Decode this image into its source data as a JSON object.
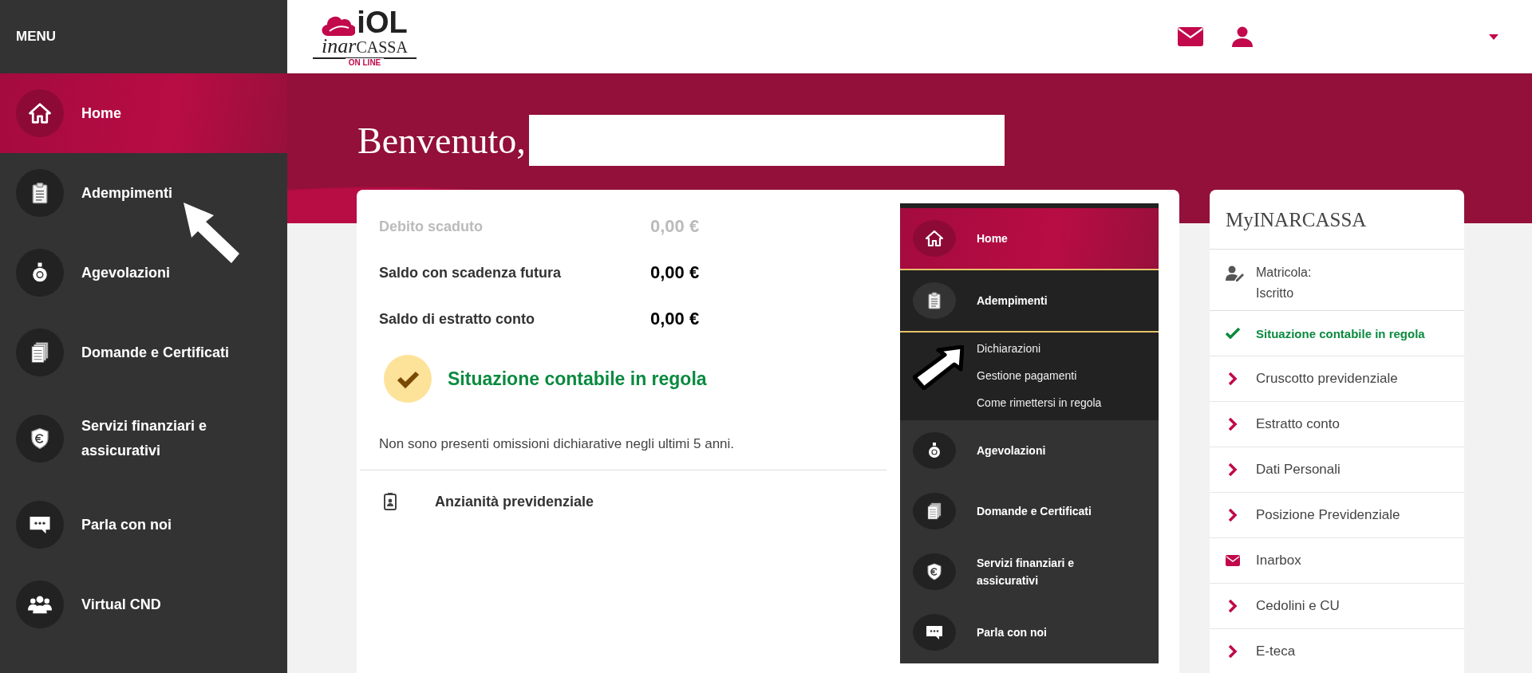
{
  "sidebar": {
    "title": "MENU",
    "items": [
      {
        "label": "Home",
        "kind": "home",
        "selected": true
      },
      {
        "label": "Adempimenti",
        "kind": "clipboard",
        "selected": false
      },
      {
        "label": "Agevolazioni",
        "kind": "piggy",
        "selected": false
      },
      {
        "label": "Domande e Certificati",
        "kind": "documents",
        "selected": false
      },
      {
        "label": "Servizi finanziari e assicurativi",
        "kind": "shield",
        "selected": false
      },
      {
        "label": "Parla con noi",
        "kind": "chat",
        "selected": false
      },
      {
        "label": "Virtual CND",
        "kind": "group",
        "selected": false
      }
    ]
  },
  "header": {
    "logo": {
      "top": "iOL",
      "script": "inar",
      "caps": "CASSA",
      "tagline": "ON LINE"
    }
  },
  "hero": {
    "title": "Benvenuto,"
  },
  "summary": {
    "rows": [
      {
        "label": "Debito scaduto",
        "amount": "0,00 €",
        "muted": true
      },
      {
        "label": "Saldo con scadenza futura",
        "amount": "0,00 €",
        "muted": false
      },
      {
        "label": "Saldo di estratto conto",
        "amount": "0,00 €",
        "muted": false
      }
    ],
    "status": "Situazione contabile in regola",
    "note": "Non sono presenti omissioni dichiarative negli ultimi 5 anni.",
    "link": "Anzianità previdenziale"
  },
  "embedded_menu": {
    "items": [
      {
        "label": "Home",
        "kind": "home",
        "selected": true,
        "expanded": false
      },
      {
        "label": "Adempimenti",
        "kind": "clipboard",
        "selected": false,
        "expanded": true,
        "children": [
          {
            "label": "Dichiarazioni"
          },
          {
            "label": "Gestione pagamenti"
          },
          {
            "label": "Come rimettersi in regola"
          }
        ]
      },
      {
        "label": "Agevolazioni",
        "kind": "piggy",
        "selected": false,
        "expanded": false
      },
      {
        "label": "Domande e Certificati",
        "kind": "documents",
        "selected": false,
        "expanded": false
      },
      {
        "label": "Servizi finanziari e assicurativi",
        "kind": "shield",
        "selected": false,
        "expanded": false
      },
      {
        "label": "Parla con noi",
        "kind": "chat",
        "selected": false,
        "expanded": false
      }
    ]
  },
  "myinarcassa": {
    "title": "MyINARCASSA",
    "profile": [
      "Matricola:",
      "Iscritto"
    ],
    "links": [
      {
        "label": "Situazione contabile in regola",
        "kind": "check"
      },
      {
        "label": "Cruscotto previdenziale",
        "kind": "chevron"
      },
      {
        "label": "Estratto conto",
        "kind": "chevron"
      },
      {
        "label": "Dati Personali",
        "kind": "chevron"
      },
      {
        "label": "Posizione Previdenziale",
        "kind": "chevron"
      },
      {
        "label": "Inarbox",
        "kind": "mail"
      },
      {
        "label": "Cedolini e CU",
        "kind": "chevron"
      },
      {
        "label": "E-teca",
        "kind": "chevron"
      }
    ]
  }
}
